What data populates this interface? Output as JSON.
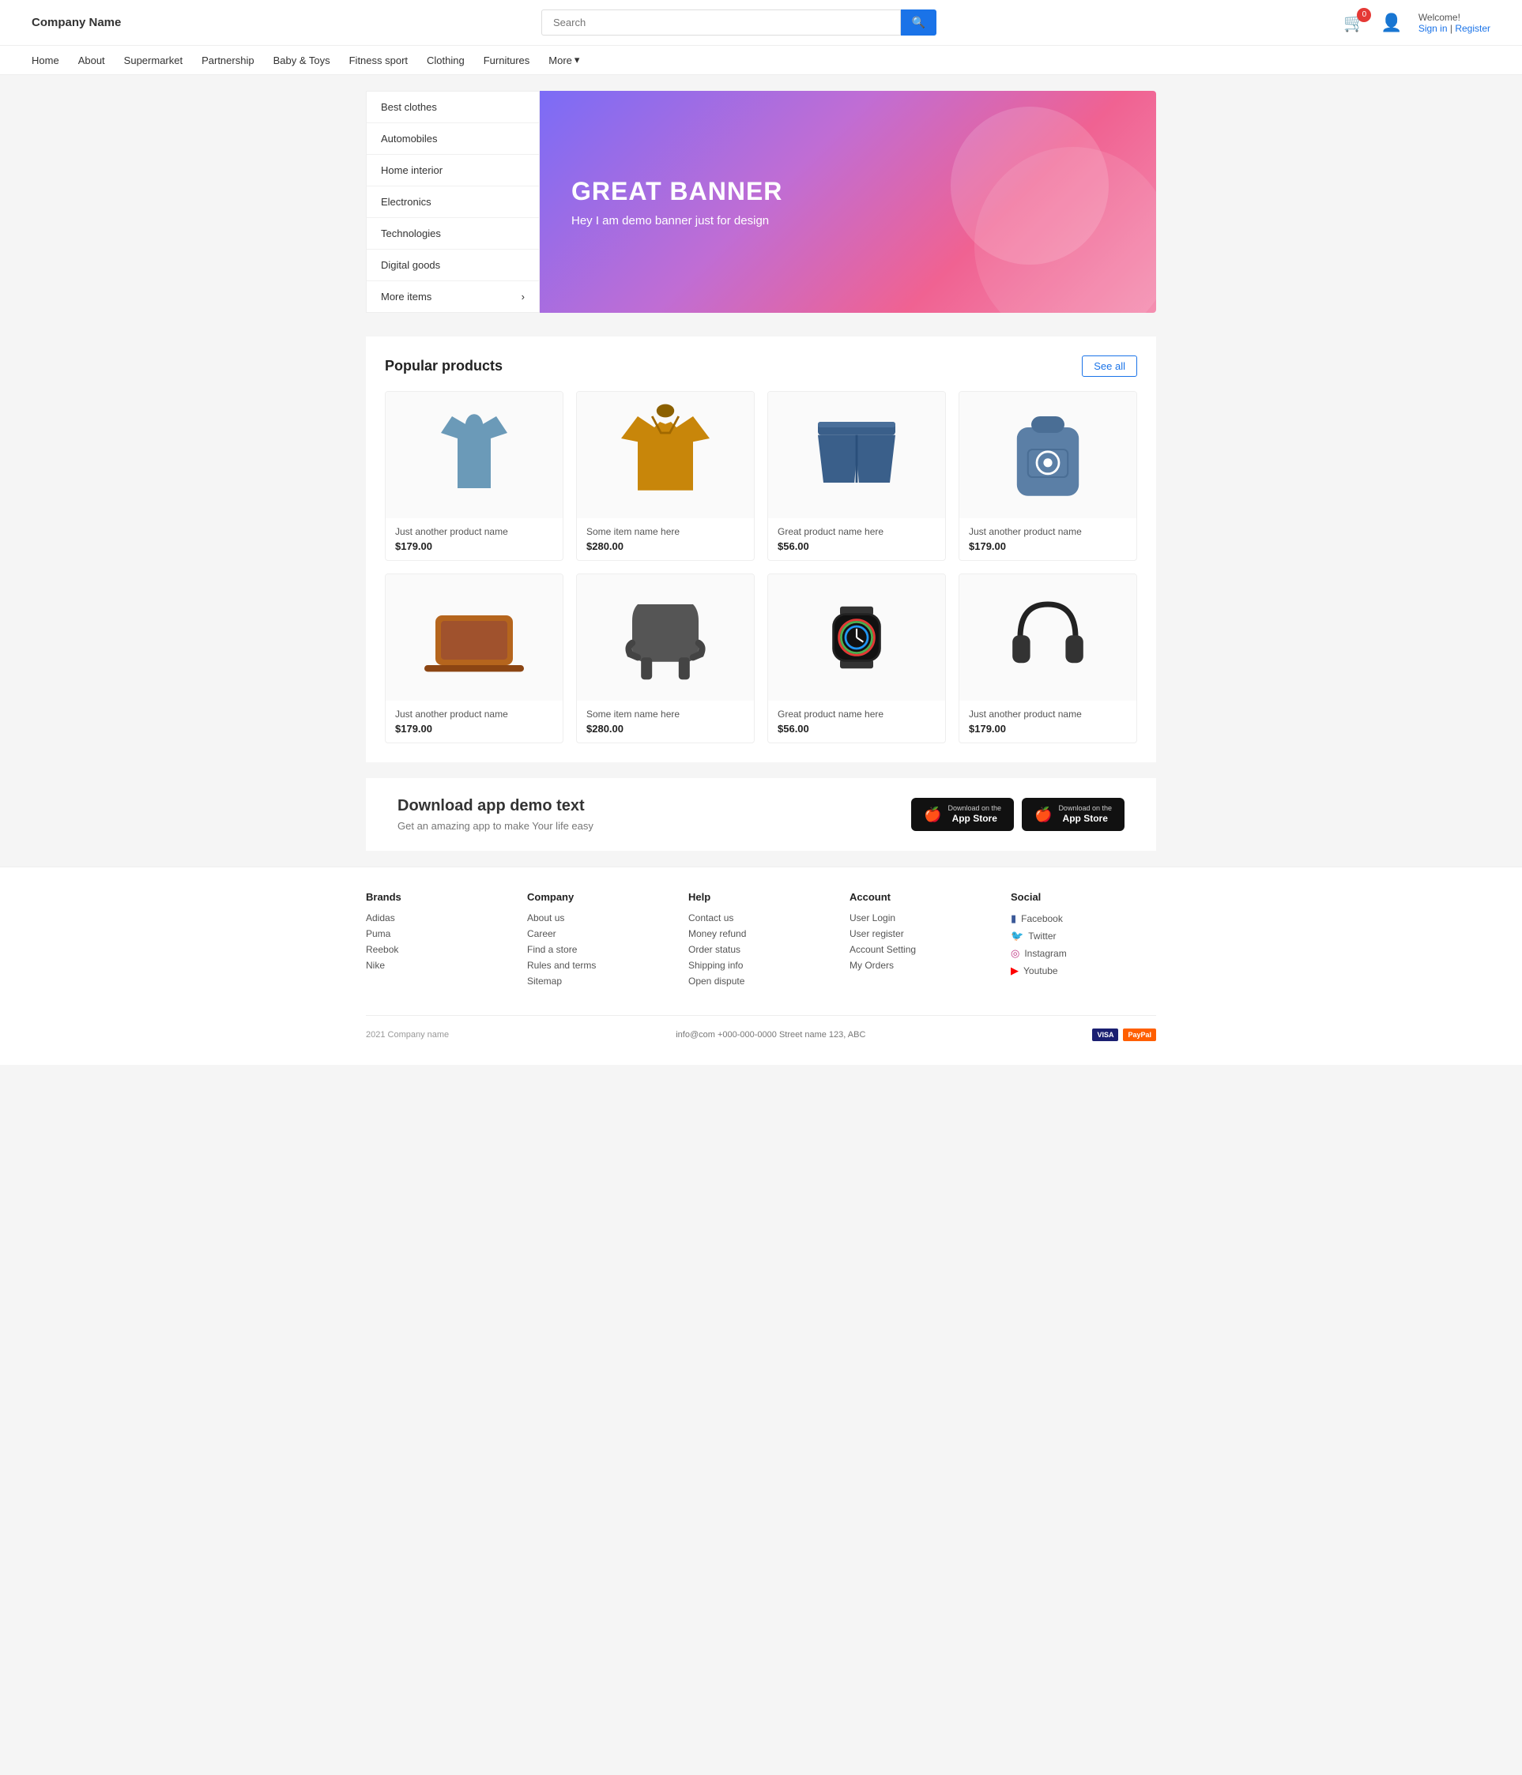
{
  "header": {
    "logo": "Company Name",
    "search_placeholder": "Search",
    "cart_count": "0",
    "welcome": "Welcome!",
    "signin": "Sign in",
    "register": "Register"
  },
  "nav": {
    "items": [
      {
        "label": "Home"
      },
      {
        "label": "About"
      },
      {
        "label": "Supermarket"
      },
      {
        "label": "Partnership"
      },
      {
        "label": "Baby &amp; Toys"
      },
      {
        "label": "Fitness sport"
      },
      {
        "label": "Clothing"
      },
      {
        "label": "Furnitures"
      },
      {
        "label": "More"
      }
    ]
  },
  "sidebar": {
    "items": [
      {
        "label": "Best clothes"
      },
      {
        "label": "Automobiles"
      },
      {
        "label": "Home interior"
      },
      {
        "label": "Electronics"
      },
      {
        "label": "Technologies"
      },
      {
        "label": "Digital goods"
      },
      {
        "label": "More items",
        "has_arrow": true
      }
    ]
  },
  "banner": {
    "title": "GREAT BANNER",
    "subtitle": "Hey I am demo banner just for design"
  },
  "products": {
    "section_title": "Popular products",
    "see_all": "See all",
    "items": [
      {
        "name": "Just another product name",
        "price": "$179.00",
        "color": "#6b9ab8",
        "type": "shirt"
      },
      {
        "name": "Some item name here",
        "price": "$280.00",
        "color": "#c8860a",
        "type": "jacket"
      },
      {
        "name": "Great product name here",
        "price": "$56.00",
        "color": "#3a5f8a",
        "type": "shorts"
      },
      {
        "name": "Just another product name",
        "price": "$179.00",
        "color": "#5b7fa6",
        "type": "backpack"
      },
      {
        "name": "Just another product name",
        "price": "$179.00",
        "color": "#b5651d",
        "type": "laptop"
      },
      {
        "name": "Some item name here",
        "price": "$280.00",
        "color": "#555",
        "type": "chair"
      },
      {
        "name": "Great product name here",
        "price": "$56.00",
        "color": "#222",
        "type": "watch"
      },
      {
        "name": "Just another product name",
        "price": "$179.00",
        "color": "#222",
        "type": "headphones"
      }
    ]
  },
  "download": {
    "title": "Download app demo text",
    "subtitle": "Get an amazing app to make Your life easy",
    "app_store_label": "Download on the",
    "app_store_name": "App Store",
    "google_play_label": "Download on the",
    "google_play_name": "App Store"
  },
  "footer": {
    "brands": {
      "title": "Brands",
      "items": [
        "Adidas",
        "Puma",
        "Reebok",
        "Nike"
      ]
    },
    "company": {
      "title": "Company",
      "items": [
        "About us",
        "Career",
        "Find a store",
        "Rules and terms",
        "Sitemap"
      ]
    },
    "help": {
      "title": "Help",
      "items": [
        "Contact us",
        "Money refund",
        "Order status",
        "Shipping info",
        "Open dispute"
      ]
    },
    "account": {
      "title": "Account",
      "items": [
        "User Login",
        "User register",
        "Account Setting",
        "My Orders"
      ]
    },
    "social": {
      "title": "Social",
      "items": [
        {
          "label": "Facebook",
          "icon": "f"
        },
        {
          "label": "Twitter",
          "icon": "t"
        },
        {
          "label": "Instagram",
          "icon": "i"
        },
        {
          "label": "Youtube",
          "icon": "y"
        }
      ]
    },
    "bottom": {
      "copyright": "2021 Company name",
      "contact": "info@com  +000-000-0000  Street name 123, ABC"
    }
  }
}
